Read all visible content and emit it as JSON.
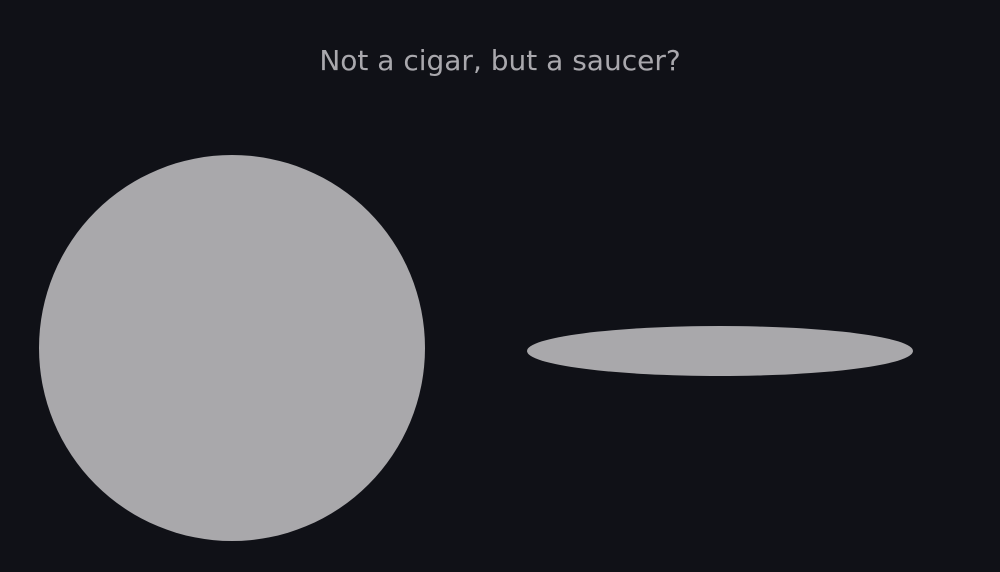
{
  "title": "Not a cigar, but a saucer?",
  "colors": {
    "background": "#101117",
    "shape_fill": "#a9a8ab",
    "title_text": "#a9a8ad"
  },
  "shapes": [
    {
      "name": "circle",
      "kind": "circle"
    },
    {
      "name": "saucer",
      "kind": "ellipse"
    }
  ]
}
